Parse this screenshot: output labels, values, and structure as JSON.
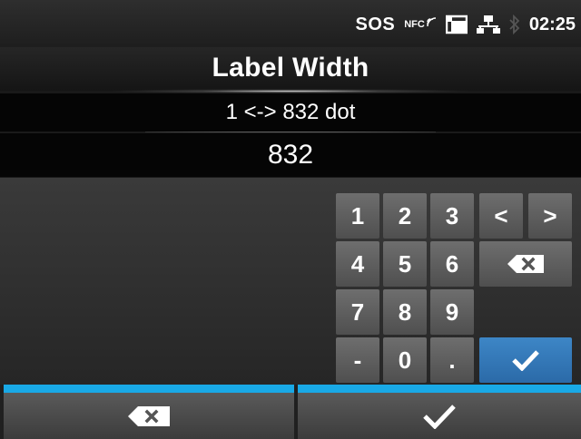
{
  "status_bar": {
    "sos_label": "SOS",
    "nfc_label": "NFC",
    "time": "02:25",
    "icons": [
      "nfc-icon",
      "sd-card-icon",
      "network-icon",
      "bluetooth-icon"
    ]
  },
  "header": {
    "title": "Label Width"
  },
  "range": {
    "text": "1 <-> 832 dot"
  },
  "input": {
    "value": "832"
  },
  "keypad": {
    "keys": [
      "1",
      "2",
      "3",
      "4",
      "5",
      "6",
      "7",
      "8",
      "9",
      "-",
      "0",
      "."
    ],
    "left_arrow": "<",
    "right_arrow": ">",
    "icons": [
      "backspace-icon",
      "checkmark-icon"
    ]
  },
  "bottom_bar": {
    "icons": [
      "backspace-icon",
      "checkmark-icon"
    ]
  },
  "colors": {
    "accent_blue": "#19a9e6",
    "enter_key": "#2e73b4",
    "key_gray": "#5e5e5e"
  }
}
